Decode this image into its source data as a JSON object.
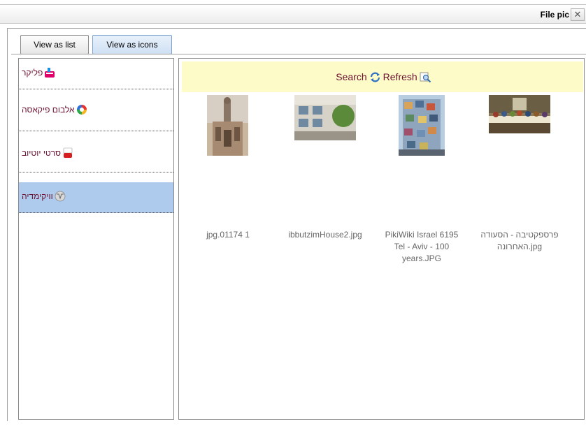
{
  "dialog": {
    "title": "File pic",
    "close_glyph": "✕"
  },
  "toolbar": {
    "view_list_label": "View as list",
    "view_icons_label": "View as icons"
  },
  "sidebar": {
    "items": [
      {
        "label": "פליקר",
        "icon": "flickr-icon"
      },
      {
        "label": "אלבום פיקאסה",
        "icon": "picasa-icon"
      },
      {
        "label": "סרטי יוטיוב",
        "icon": "youtube-icon"
      },
      {
        "label": "וויקימדיה",
        "icon": "wikimedia-icon",
        "selected": true
      }
    ]
  },
  "search_bar": {
    "search_label": "Search",
    "refresh_label": "Refresh"
  },
  "thumbnails": [
    {
      "label_lines": [
        "jpg.01174 1"
      ]
    },
    {
      "label_lines": [
        "ibbutzimHouse2.jpg"
      ]
    },
    {
      "label_lines": [
        "PikiWiki Israel 6195",
        "Tel - Aviv - 100",
        "years.JPG"
      ]
    },
    {
      "label_lines": [
        "פרספקטיבה - הסעודה",
        "האחרונה.jpg"
      ]
    }
  ],
  "colors": {
    "link_text": "#6b1030",
    "selected_bg": "#aecbee",
    "search_bar_bg": "#fdfbc8"
  }
}
